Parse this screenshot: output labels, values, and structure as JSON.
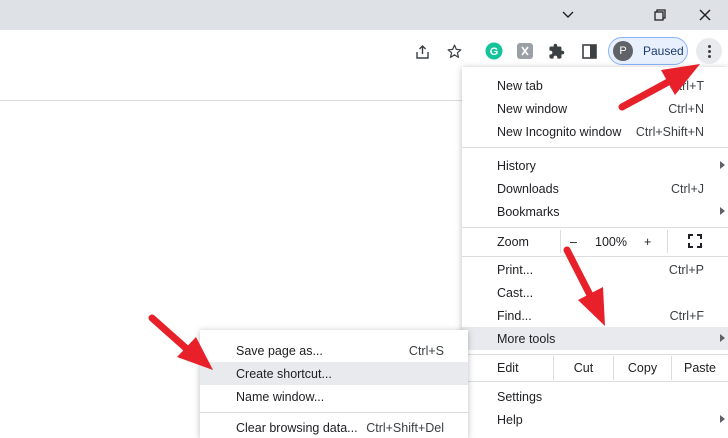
{
  "window_controls": {
    "tab_search": "chevron-down-icon",
    "restore": "restore-icon",
    "close": "close-icon"
  },
  "toolbar": {
    "share_icon": "share-icon",
    "bookmark_icon": "star-icon",
    "extensions": [
      "grammarly-icon",
      "extension-grey-icon",
      "puzzle-icon",
      "side-panel-icon"
    ],
    "profile": {
      "initial": "P",
      "label": "Paused"
    },
    "menu_icon": "three-dots-icon"
  },
  "main_menu": {
    "new_tab": {
      "label": "New tab",
      "shortcut": "Ctrl+T"
    },
    "new_window": {
      "label": "New window",
      "shortcut": "Ctrl+N"
    },
    "new_incognito": {
      "label": "New Incognito window",
      "shortcut": "Ctrl+Shift+N"
    },
    "history": {
      "label": "History"
    },
    "downloads": {
      "label": "Downloads",
      "shortcut": "Ctrl+J"
    },
    "bookmarks": {
      "label": "Bookmarks"
    },
    "zoom": {
      "label": "Zoom",
      "minus": "–",
      "value": "100%",
      "plus": "+"
    },
    "print": {
      "label": "Print...",
      "shortcut": "Ctrl+P"
    },
    "cast": {
      "label": "Cast..."
    },
    "find": {
      "label": "Find...",
      "shortcut": "Ctrl+F"
    },
    "more_tools": {
      "label": "More tools"
    },
    "edit": {
      "label": "Edit",
      "cut": "Cut",
      "copy": "Copy",
      "paste": "Paste"
    },
    "settings": {
      "label": "Settings"
    },
    "help": {
      "label": "Help"
    }
  },
  "sub_menu": {
    "save_page": {
      "label": "Save page as...",
      "shortcut": "Ctrl+S"
    },
    "create_shortcut": {
      "label": "Create shortcut..."
    },
    "name_window": {
      "label": "Name window..."
    },
    "clear_data": {
      "label": "Clear browsing data...",
      "shortcut": "Ctrl+Shift+Del"
    }
  },
  "colors": {
    "annotation_red": "#e8202a",
    "highlight": "#e8eaed",
    "profile_border": "#8ab4f8"
  }
}
